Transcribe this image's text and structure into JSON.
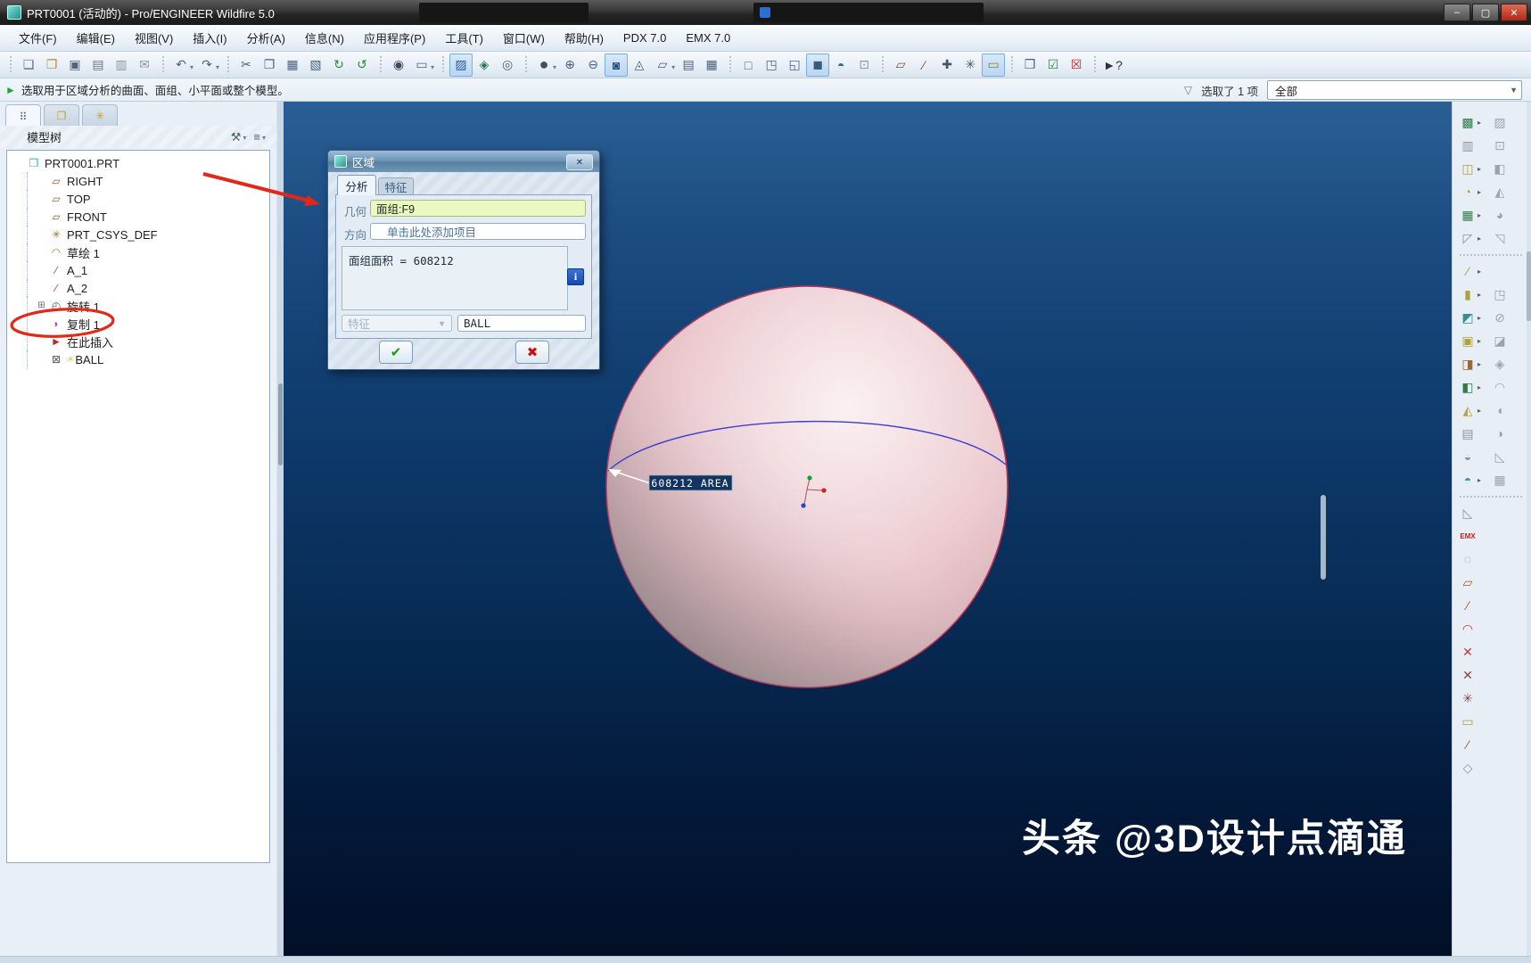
{
  "title_bar": {
    "title": "PRT0001 (活动的) - Pro/ENGINEER Wildfire 5.0",
    "buttons": [
      {
        "name": "minimize-button",
        "glyph": "–"
      },
      {
        "name": "maximize-button",
        "glyph": "▢"
      },
      {
        "name": "close-button",
        "glyph": "✕"
      }
    ]
  },
  "menu_bar": {
    "items": [
      "文件(F)",
      "编辑(E)",
      "视图(V)",
      "插入(I)",
      "分析(A)",
      "信息(N)",
      "应用程序(P)",
      "工具(T)",
      "窗口(W)",
      "帮助(H)",
      "PDX 7.0",
      "EMX 7.0"
    ]
  },
  "main_toolbar": {
    "groups": [
      [
        {
          "name": "new-file-icon",
          "glyph": "❏",
          "color": "#5a6a7c"
        },
        {
          "name": "open-file-icon",
          "glyph": "❐",
          "color": "#b08a3a"
        },
        {
          "name": "save-icon",
          "glyph": "▣",
          "color": "#55627a"
        },
        {
          "name": "print-icon",
          "glyph": "▤",
          "color": "#6a7788"
        },
        {
          "name": "print-stamp-icon",
          "glyph": "▥",
          "color": "#8a93a0"
        },
        {
          "name": "email-link-icon",
          "glyph": "✉",
          "color": "#8a93a0"
        }
      ],
      [
        {
          "name": "undo-icon",
          "glyph": "↶",
          "dd": true
        },
        {
          "name": "redo-icon",
          "glyph": "↷",
          "dd": true
        }
      ],
      [
        {
          "name": "cut-icon",
          "glyph": "✂"
        },
        {
          "name": "copy-icon",
          "glyph": "❐"
        },
        {
          "name": "paste-icon",
          "glyph": "▦"
        },
        {
          "name": "paste-special-icon",
          "glyph": "▧"
        },
        {
          "name": "regenerate-icon",
          "glyph": "↻",
          "color": "#2a8a3a"
        },
        {
          "name": "auto-regenerate-icon",
          "glyph": "↺",
          "color": "#2a8a3a"
        }
      ],
      [
        {
          "name": "search-binoculars-icon",
          "glyph": "◉",
          "color": "#3a4a60"
        },
        {
          "name": "select-box-icon",
          "glyph": "▭",
          "dd": true
        }
      ],
      [
        {
          "name": "display-filter-icon",
          "glyph": "▨",
          "active": true,
          "color": "#2a5a9a"
        },
        {
          "name": "relations-nodes-icon",
          "glyph": "◈",
          "color": "#2a7a4a"
        },
        {
          "name": "gear-icon",
          "glyph": "◎",
          "color": "#556070"
        }
      ],
      [
        {
          "name": "shaded-sphere-icon",
          "glyph": "●",
          "big": true,
          "dd": true,
          "color": "#4a4f55"
        },
        {
          "name": "zoom-in-icon",
          "glyph": "⊕"
        },
        {
          "name": "zoom-out-icon",
          "glyph": "⊖"
        },
        {
          "name": "refit-icon",
          "glyph": "◙",
          "active": true,
          "color": "#24507e"
        },
        {
          "name": "reorient-icon",
          "glyph": "◬"
        },
        {
          "name": "annotation-icon",
          "glyph": "▱",
          "dd": true
        },
        {
          "name": "layers-icon",
          "glyph": "▤"
        },
        {
          "name": "view-manager-icon",
          "glyph": "▦"
        }
      ],
      [
        {
          "name": "wireframe-icon",
          "glyph": "□"
        },
        {
          "name": "hidden-line-icon",
          "glyph": "◳"
        },
        {
          "name": "no-hidden-icon",
          "glyph": "◱"
        },
        {
          "name": "shaded-icon",
          "glyph": "◼",
          "active": true,
          "color": "#3a5a7c"
        },
        {
          "name": "enhanced-shaded-icon",
          "glyph": "◓",
          "color": "#2a6ab0"
        },
        {
          "name": "component-display-icon",
          "glyph": "⊡",
          "color": "#8a93a0"
        }
      ],
      [
        {
          "name": "plane-display-icon",
          "glyph": "▱",
          "color": "#8a4a2a"
        },
        {
          "name": "axis-display-icon",
          "glyph": "∕",
          "color": "#8a4a2a"
        },
        {
          "name": "point-display-icon",
          "glyph": "✚",
          "color": "#445566"
        },
        {
          "name": "csys-display-icon",
          "glyph": "✳",
          "color": "#445566"
        },
        {
          "name": "tag-display-icon",
          "glyph": "▭",
          "active": true,
          "color": "#8a7a20"
        }
      ],
      [
        {
          "name": "new-window-icon",
          "glyph": "❒"
        },
        {
          "name": "activate-window-icon",
          "glyph": "☑",
          "color": "#2a8a3a"
        },
        {
          "name": "close-window-icon",
          "glyph": "☒",
          "color": "#c22222"
        }
      ],
      [
        {
          "name": "context-help-icon",
          "glyph": "►?",
          "color": "#333333"
        }
      ]
    ]
  },
  "message_bar": {
    "prompt_icon": "►",
    "text": "选取用于区域分析的曲面、面组、小平面或整个模型。",
    "filter_icon": "▽",
    "selected_count_text": "选取了 1 项",
    "filter_value": "全部",
    "dropdown_arrow": "▼"
  },
  "left_panel": {
    "tabs": [
      {
        "name": "model-tree-tab",
        "glyph": "⠿",
        "color": "#46617e",
        "active": true
      },
      {
        "name": "folder-browser-tab",
        "glyph": "❐",
        "color": "#c8a020",
        "active": false
      },
      {
        "name": "favorites-tab",
        "glyph": "✳",
        "color": "#c8a020",
        "active": false
      }
    ],
    "header": "模型树",
    "header_tools": [
      {
        "name": "tree-settings-icon",
        "glyph": "⚒",
        "dd": true
      },
      {
        "name": "tree-columns-icon",
        "glyph": "≡",
        "dd": true
      }
    ]
  },
  "model_tree": {
    "items": [
      {
        "label": "PRT0001.PRT",
        "icon": "part-icon",
        "glyph": "❒",
        "color": "#2ab3c4",
        "level": 0
      },
      {
        "label": "RIGHT",
        "icon": "datum-plane-icon",
        "glyph": "▱",
        "color": "#9a5a2a",
        "level": 1
      },
      {
        "label": "TOP",
        "icon": "datum-plane-icon",
        "glyph": "▱",
        "color": "#9a5a2a",
        "level": 1
      },
      {
        "label": "FRONT",
        "icon": "datum-plane-icon",
        "glyph": "▱",
        "color": "#9a5a2a",
        "level": 1
      },
      {
        "label": "PRT_CSYS_DEF",
        "icon": "csys-icon",
        "glyph": "✳",
        "color": "#9a7a2a",
        "level": 1
      },
      {
        "label": "草绘 1",
        "icon": "sketch-icon",
        "glyph": "◠",
        "color": "#b08030",
        "level": 1
      },
      {
        "label": "A_1",
        "icon": "axis-icon",
        "glyph": "∕",
        "color": "#8a4a2a",
        "level": 1
      },
      {
        "label": "A_2",
        "icon": "axis-icon",
        "glyph": "∕",
        "color": "#8a4a2a",
        "level": 1
      },
      {
        "label": "旋转 1",
        "icon": "revolve-icon",
        "glyph": "◴",
        "color": "#556070",
        "level": 1,
        "expander": "⊞"
      },
      {
        "label": "复制 1",
        "icon": "copy-geometry-icon",
        "glyph": "◗",
        "color": "#b050b0",
        "level": 1,
        "annotated": true
      },
      {
        "label": "在此插入",
        "icon": "insert-here-icon",
        "glyph": "►",
        "color": "#cc2020",
        "level": 1
      },
      {
        "label": "BALL",
        "icon": "analysis-feature-icon",
        "glyph": "⊠",
        "color": "#55606a",
        "level": 1,
        "prefix": "✳",
        "prefix_color": "#e8c520"
      }
    ]
  },
  "dialog": {
    "title": "区域",
    "close_glyph": "✕",
    "tabs": [
      {
        "label": "分析",
        "active": true
      },
      {
        "label": "特征",
        "active": false
      }
    ],
    "geometry_label": "几何",
    "geometry_value": "面组:F9",
    "direction_label": "方向",
    "direction_placeholder": "单击此处添加项目",
    "result_text": "面组面积 = 608212",
    "info_glyph": "i",
    "feature_select_label": "特征",
    "name_value": "BALL",
    "ok_glyph": "✔",
    "cancel_glyph": "✖"
  },
  "viewport": {
    "area_label": "608212 AREA",
    "watermark": "头条 @3D设计点滴通"
  },
  "right_toolbar": {
    "rows": [
      {
        "left": {
          "name": "style-tool-icon",
          "glyph": "▩",
          "color": "#2f7d46"
        },
        "fly": true,
        "right": {
          "name": "slot-tool-icon",
          "glyph": "▨"
        }
      },
      {
        "left": {
          "name": "mold-tool-icon",
          "glyph": "▥",
          "color": "#8a939e"
        },
        "fly": false,
        "right": {
          "name": "frame-tool-icon",
          "glyph": "⊡"
        }
      },
      {
        "left": {
          "name": "hole-tool-icon",
          "glyph": "◫",
          "color": "#b0a040"
        },
        "fly": true,
        "right": {
          "name": "shell-tool-icon",
          "glyph": "◧"
        }
      },
      {
        "left": {
          "name": "round-tool-icon",
          "glyph": "◔",
          "color": "#c2a238"
        },
        "fly": true,
        "right": {
          "name": "draft-tool-icon",
          "glyph": "◭"
        }
      },
      {
        "left": {
          "name": "pattern-tool-icon",
          "glyph": "▦",
          "color": "#2f7d46"
        },
        "fly": true,
        "right": {
          "name": "round-edge-tool-icon",
          "glyph": "◕"
        }
      },
      {
        "left": {
          "name": "screw-tool-icon",
          "glyph": "◸",
          "color": "#8a939e"
        },
        "fly": true,
        "right": {
          "name": "chamfer-tool-icon",
          "glyph": "◹"
        }
      },
      {
        "left": {
          "name": "pen-tool-icon",
          "glyph": "∕",
          "color": "#b0a040"
        },
        "fly": true,
        "right": null
      },
      {
        "left": {
          "name": "column-tool-icon",
          "glyph": "▮",
          "color": "#b0a040"
        },
        "fly": true,
        "right": {
          "name": "extrude-tool-icon",
          "glyph": "◳"
        }
      },
      {
        "left": {
          "name": "camera-tool-icon",
          "glyph": "◩",
          "color": "#3a8a9a"
        },
        "fly": true,
        "right": {
          "name": "revolve-tool-icon",
          "glyph": "⊘"
        }
      },
      {
        "left": {
          "name": "mug-tool-icon",
          "glyph": "▣",
          "color": "#b0a040"
        },
        "fly": true,
        "right": {
          "name": "sweep-tool-icon",
          "glyph": "◪"
        }
      },
      {
        "left": {
          "name": "wrap-tool-icon",
          "glyph": "◨",
          "color": "#9a6a3a"
        },
        "fly": true,
        "right": {
          "name": "blend-tool-icon",
          "glyph": "◈"
        }
      },
      {
        "left": {
          "name": "rib-tool-icon",
          "glyph": "◧",
          "color": "#2f7d46"
        },
        "fly": true,
        "right": {
          "name": "boundary-tool-icon",
          "glyph": "◠"
        }
      },
      {
        "left": {
          "name": "trajectory-tool-icon",
          "glyph": "◭",
          "color": "#c2a238"
        },
        "fly": true,
        "right": {
          "name": "mirror-tool-icon",
          "glyph": "◖"
        }
      },
      {
        "left": {
          "name": "mask-tool-icon",
          "glyph": "▤",
          "color": "#8a939e"
        },
        "fly": false,
        "right": {
          "name": "merge-tool-icon",
          "glyph": "◑"
        }
      },
      {
        "left": {
          "name": "pump-tool-icon",
          "glyph": "◒",
          "color": "#8a939e"
        },
        "fly": false,
        "right": {
          "name": "trim-tool-icon",
          "glyph": "◺"
        }
      },
      {
        "left": {
          "name": "box-tool-icon",
          "glyph": "◓",
          "color": "#3a9aa8"
        },
        "fly": true,
        "right": {
          "name": "grid-tool-icon",
          "glyph": "▦"
        }
      }
    ],
    "singles": [
      {
        "name": "surface-tool-icon",
        "glyph": "◺",
        "color": "#8a939e"
      },
      {
        "name": "emx-tool-icon",
        "glyph": "EMX",
        "color": "#cc2222",
        "text": true
      },
      {
        "name": "freestyle-tool-icon",
        "glyph": "◌",
        "color": "#8a939e"
      },
      {
        "name": "datum-plane-tool-icon",
        "glyph": "▱",
        "color": "#9a5a2a"
      },
      {
        "name": "datum-axis-tool-icon",
        "glyph": "∕",
        "color": "#9a5a2a"
      },
      {
        "name": "curve-tool-icon",
        "glyph": "◠",
        "color": "#cc3333"
      },
      {
        "name": "point-tool-icon",
        "glyph": "✕",
        "color": "#cc3333"
      },
      {
        "name": "offset-point-tool-icon",
        "glyph": "✕",
        "color": "#884444"
      },
      {
        "name": "csys-tool-icon",
        "glyph": "✳",
        "color": "#884444"
      },
      {
        "name": "note-tool-icon",
        "glyph": "▭",
        "color": "#b0a040"
      },
      {
        "name": "sketch-line-tool-icon",
        "glyph": "∕",
        "color": "#9a5a2a"
      },
      {
        "name": "analysis-tool-icon",
        "glyph": "◇",
        "color": "#8a939e"
      }
    ]
  }
}
